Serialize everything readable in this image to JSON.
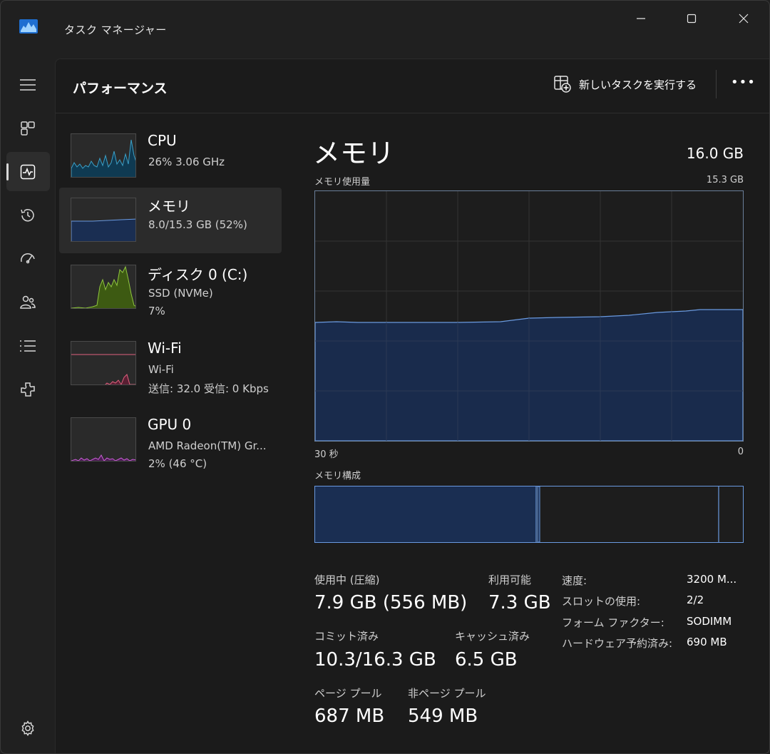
{
  "window": {
    "title": "タスク マネージャー"
  },
  "header": {
    "page_title": "パフォーマンス",
    "run_task_label": "新しいタスクを実行する",
    "more": "•••"
  },
  "nav": [
    "menu-icon",
    "processes-icon",
    "performance-icon",
    "app-history-icon",
    "startup-icon",
    "users-icon",
    "details-icon",
    "services-icon",
    "settings-icon"
  ],
  "resources": [
    {
      "name": "CPU",
      "sub1": "26% 3.06 GHz",
      "sub2": "",
      "color": "#3aa0c8"
    },
    {
      "name": "メモリ",
      "sub1": "8.0/15.3 GB (52%)",
      "sub2": "",
      "color": "#6a9ae0"
    },
    {
      "name": "ディスク 0 (C:)",
      "sub1": "SSD (NVMe)",
      "sub2": "7%",
      "color": "#8fc53f"
    },
    {
      "name": "Wi-Fi",
      "sub1": "Wi-Fi",
      "sub2": "送信: 32.0 受信: 0 Kbps",
      "color": "#e0607e"
    },
    {
      "name": "GPU 0",
      "sub1": "AMD Radeon(TM) Gr...",
      "sub2": "2% (46 °C)",
      "color": "#c95fd6"
    }
  ],
  "detail": {
    "title": "メモリ",
    "total": "16.0 GB",
    "usage_label": "メモリ使用量",
    "usage_max": "15.3 GB",
    "time_left": "30 秒",
    "time_right": "0",
    "composition_label": "メモリ構成",
    "usage_percent": 52,
    "composition_fractions": {
      "in_use": 0.517,
      "modified": 0.012,
      "standby": 0.415,
      "free": 0.056
    }
  },
  "stats": [
    {
      "label": "使用中 (圧縮)",
      "value": "7.9 GB (556 MB)"
    },
    {
      "label": "利用可能",
      "value": "7.3 GB"
    },
    {
      "label": "コミット済み",
      "value": "10.3/16.3 GB"
    },
    {
      "label": "キャッシュ済み",
      "value": "6.5 GB"
    },
    {
      "label": "ページ プール",
      "value": "687 MB"
    },
    {
      "label": "非ページ プール",
      "value": "549 MB"
    }
  ],
  "properties": [
    {
      "label": "速度:",
      "value": "3200 M..."
    },
    {
      "label": "スロットの使用:",
      "value": "2/2"
    },
    {
      "label": "フォーム ファクター:",
      "value": "SODIMM"
    },
    {
      "label": "ハードウェア予約済み:",
      "value": "690 MB"
    }
  ]
}
